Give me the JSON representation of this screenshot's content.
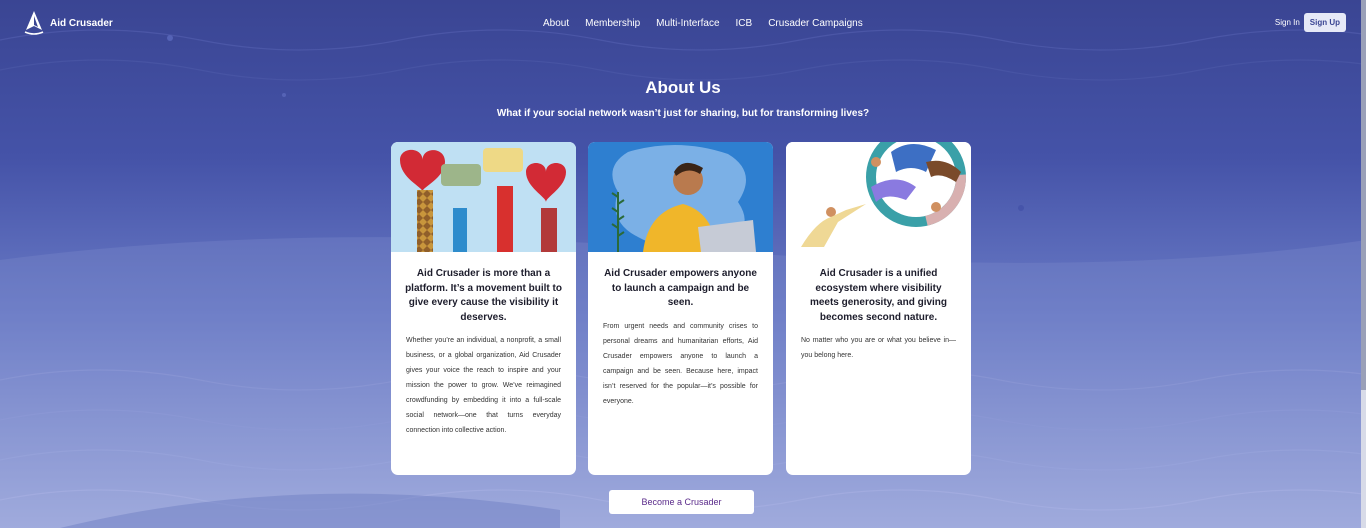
{
  "brand": {
    "name": "Aid Crusader"
  },
  "nav": {
    "items": [
      {
        "label": "About"
      },
      {
        "label": "Membership"
      },
      {
        "label": "Multi-Interface"
      },
      {
        "label": "ICB"
      },
      {
        "label": "Crusader Campaigns"
      }
    ],
    "sign_in": "Sign In",
    "sign_up": "Sign Up"
  },
  "hero": {
    "title": "About Us",
    "subtitle": "What if your social network wasn’t just for sharing, but for transforming lives?"
  },
  "cards": [
    {
      "heading": "Aid Crusader is more than a platform. It’s a movement built to give every cause the visibility it deserves.",
      "body": "Whether you’re an individual, a nonprofit, a small business, or a global organization, Aid Crusader gives your voice the reach to inspire and your mission the power to grow. We’ve reimagined crowdfunding by embedding it into a full-scale social network—one that turns everyday connection into collective action."
    },
    {
      "heading": "Aid Crusader empowers anyone to launch a campaign and be seen.",
      "body": "From urgent needs and community crises to personal dreams and humanitarian efforts, Aid Crusader empowers anyone to launch a campaign and be seen. Because here, impact isn’t reserved for the popular—it’s possible for everyone."
    },
    {
      "heading": "Aid Crusader is a unified ecosystem where visibility meets generosity, and giving becomes second nature.",
      "body": "No matter who you are or what you believe in—you belong here."
    }
  ],
  "cta": {
    "label": "Become a Crusader"
  },
  "colors": {
    "background": "#3a4593",
    "accent": "#5a2a8a",
    "card": "#ffffff"
  }
}
